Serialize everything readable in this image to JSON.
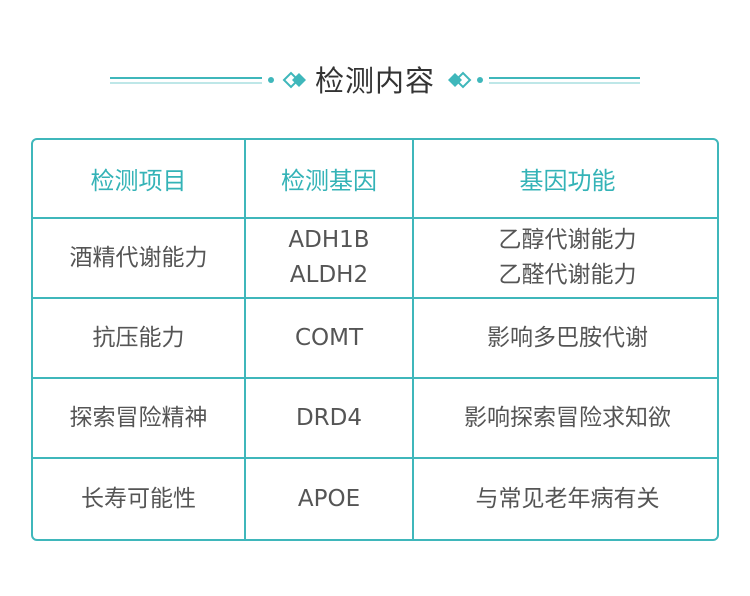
{
  "header": {
    "title": "检测内容",
    "accent_color": "#3fb7bb"
  },
  "table": {
    "columns": [
      "检测项目",
      "检测基因",
      "基因功能"
    ],
    "rows": [
      {
        "item": "酒精代谢能力",
        "genes": [
          "ADH1B",
          "ALDH2"
        ],
        "functions": [
          "乙醇代谢能力",
          "乙醛代谢能力"
        ]
      },
      {
        "item": "抗压能力",
        "genes": [
          "COMT"
        ],
        "functions": [
          "影响多巴胺代谢"
        ]
      },
      {
        "item": "探索冒险精神",
        "genes": [
          "DRD4"
        ],
        "functions": [
          "影响探索冒险求知欲"
        ]
      },
      {
        "item": "长寿可能性",
        "genes": [
          "APOE"
        ],
        "functions": [
          "与常见老年病有关"
        ]
      }
    ]
  }
}
